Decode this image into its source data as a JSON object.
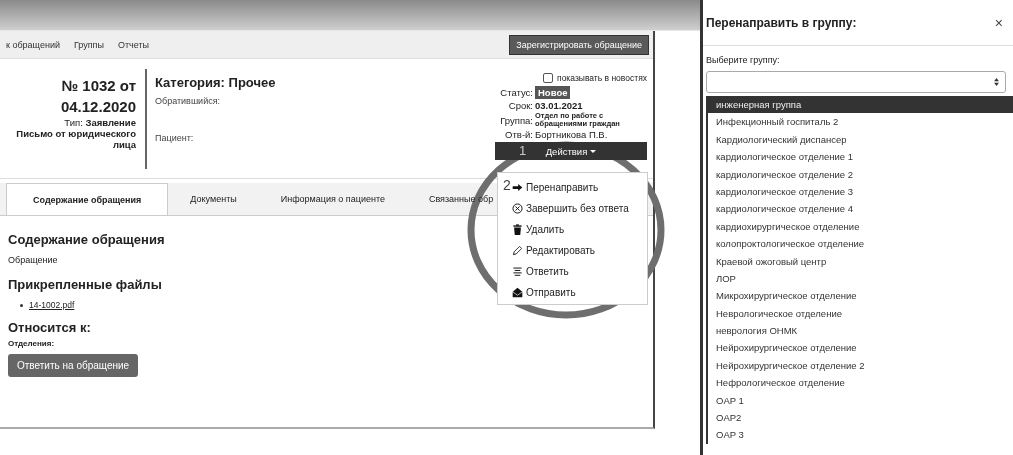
{
  "nav": {
    "items": [
      "к обращений",
      "Группы",
      "Отчеты"
    ],
    "register_button": "Зарегистрировать обращение"
  },
  "header": {
    "number": "№ 1032 от",
    "date": "04.12.2020",
    "type_label": "Тип:",
    "type_value": "Заявление",
    "subtype": "Письмо от юридического лица",
    "category": "Категория: Прочее",
    "applicant_label": "Обратившийся:",
    "patient_label": "Пациент:"
  },
  "news_checkbox": {
    "label": "показывать в новостях",
    "checked": false
  },
  "details": [
    {
      "label": "Статус:",
      "value": "Новое",
      "kind": "badge"
    },
    {
      "label": "Срок:",
      "value": "03.01.2021",
      "kind": "bold"
    },
    {
      "label": "Группа:",
      "value": "Отдел по работе с обращениями граждан",
      "kind": "small"
    },
    {
      "label": "Отв-й:",
      "value": "Бортникова П.В.",
      "kind": "plain"
    }
  ],
  "actions_button": {
    "label": "Действия",
    "annotation": "1"
  },
  "actions_menu": {
    "annotation": "2",
    "items": [
      "Перенаправить",
      "Завершить без ответа",
      "Удалить",
      "Редактировать",
      "Ответить",
      "Отправить"
    ]
  },
  "tabs": [
    {
      "label": "Содержание обращения",
      "selected": true
    },
    {
      "label": "Документы",
      "selected": false
    },
    {
      "label": "Информация о пациенте",
      "selected": false
    },
    {
      "label": "Связанные обр",
      "selected": false
    }
  ],
  "content": {
    "heading": "Содержание обращения",
    "text": "Обращение",
    "files_heading": "Прикрепленные файлы",
    "files": [
      "14-1002.pdf"
    ],
    "relates_heading": "Относится к:",
    "departments_label": "Отделения:",
    "reply_button": "Ответить на обращение"
  },
  "modal": {
    "title": "Перенаправить в группу:",
    "close": "×",
    "field_label": "Выберите группу:",
    "options": [
      {
        "label": "инженерная группа",
        "selected": true
      },
      {
        "label": "Инфекционный госпиталь 2",
        "selected": false
      },
      {
        "label": "Кардиологический диспансер",
        "selected": false
      },
      {
        "label": "кардиологическое отделение 1",
        "selected": false
      },
      {
        "label": "кардиологическое отделение 2",
        "selected": false
      },
      {
        "label": "кардиологическое отделение 3",
        "selected": false
      },
      {
        "label": "кардиологическое отделение 4",
        "selected": false
      },
      {
        "label": "кардиохирургическое отделение",
        "selected": false
      },
      {
        "label": "колопроктологическое отделение",
        "selected": false
      },
      {
        "label": "Краевой ожоговый центр",
        "selected": false
      },
      {
        "label": "ЛОР",
        "selected": false
      },
      {
        "label": "Микрохирургическое отделение",
        "selected": false
      },
      {
        "label": "Неврологическое отделение",
        "selected": false
      },
      {
        "label": "неврология ОНМК",
        "selected": false
      },
      {
        "label": "Нейрохирургическое отделение",
        "selected": false
      },
      {
        "label": "Нейрохирургическое отделение 2",
        "selected": false
      },
      {
        "label": "Нефрологическое отделение",
        "selected": false
      },
      {
        "label": "OAP 1",
        "selected": false
      },
      {
        "label": "OAP2",
        "selected": false
      },
      {
        "label": "OAP 3",
        "selected": false
      }
    ]
  }
}
